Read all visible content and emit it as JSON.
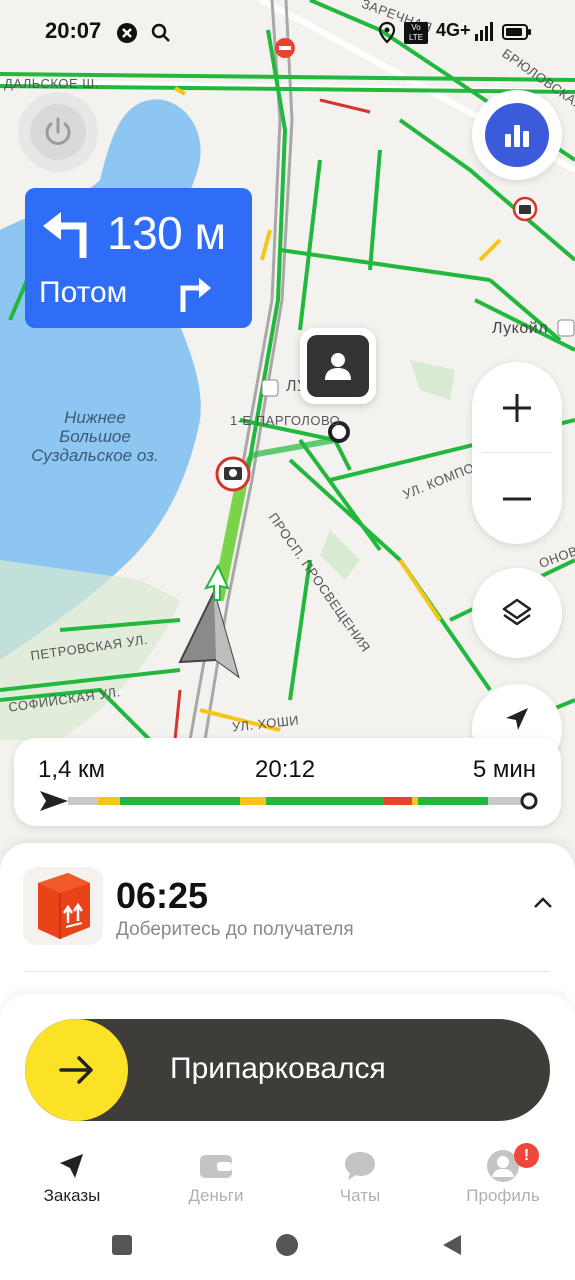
{
  "status_bar": {
    "time": "20:07",
    "network": "4G+",
    "volte": "Vo LTE",
    "icons": [
      "x-circle-icon",
      "search-icon",
      "location-pin-icon",
      "volte-icon",
      "signal-icon",
      "battery-icon"
    ]
  },
  "map": {
    "lake_label": "Нижнее Большое Суздальское оз.",
    "street_labels": [
      "ДАЛЬСКОЕ Ш.",
      "ЗАРЕЧНАЯ",
      "БРЮЛОВСКАЯ",
      "Лукойл",
      "1-Е ПАРГОЛОВО",
      "ЛУ",
      "ПРОСП. ПРОСВЕЩЕНИЯ",
      "УЛ. КОМПОЗИ",
      "ОНОВА",
      "ПЕТРОВСКАЯ УЛ.",
      "СОФИЙСКАЯ УЛ.",
      "УЛ. ХОШИ"
    ]
  },
  "maneuver": {
    "distance": "130 м",
    "then_label": "Потом",
    "primary_icon": "turn-left-arrow-icon",
    "then_icon": "turn-right-arrow-icon"
  },
  "route": {
    "distance": "1,4 км",
    "eta": "20:12",
    "duration": "5 мин"
  },
  "order": {
    "time": "06:25",
    "subtitle": "Доберитесь до получателя"
  },
  "action": {
    "slider_label": "Припарковался"
  },
  "tabs": [
    {
      "label": "Заказы",
      "icon": "navigation-arrow-icon",
      "active": true
    },
    {
      "label": "Деньги",
      "icon": "wallet-icon",
      "active": false
    },
    {
      "label": "Чаты",
      "icon": "chat-bubble-icon",
      "active": false
    },
    {
      "label": "Профиль",
      "icon": "profile-icon",
      "active": false
    }
  ],
  "profile_badge": "!",
  "colors": {
    "maneuver_blue": "#2f6df6",
    "stats_blue": "#3b5bdb",
    "slider_yellow": "#fbe226",
    "slider_dark": "#3f3d39",
    "traffic_green": "#22b83d",
    "traffic_yellow": "#f5c518",
    "traffic_red": "#e8432f",
    "badge_red": "#f1463b"
  }
}
